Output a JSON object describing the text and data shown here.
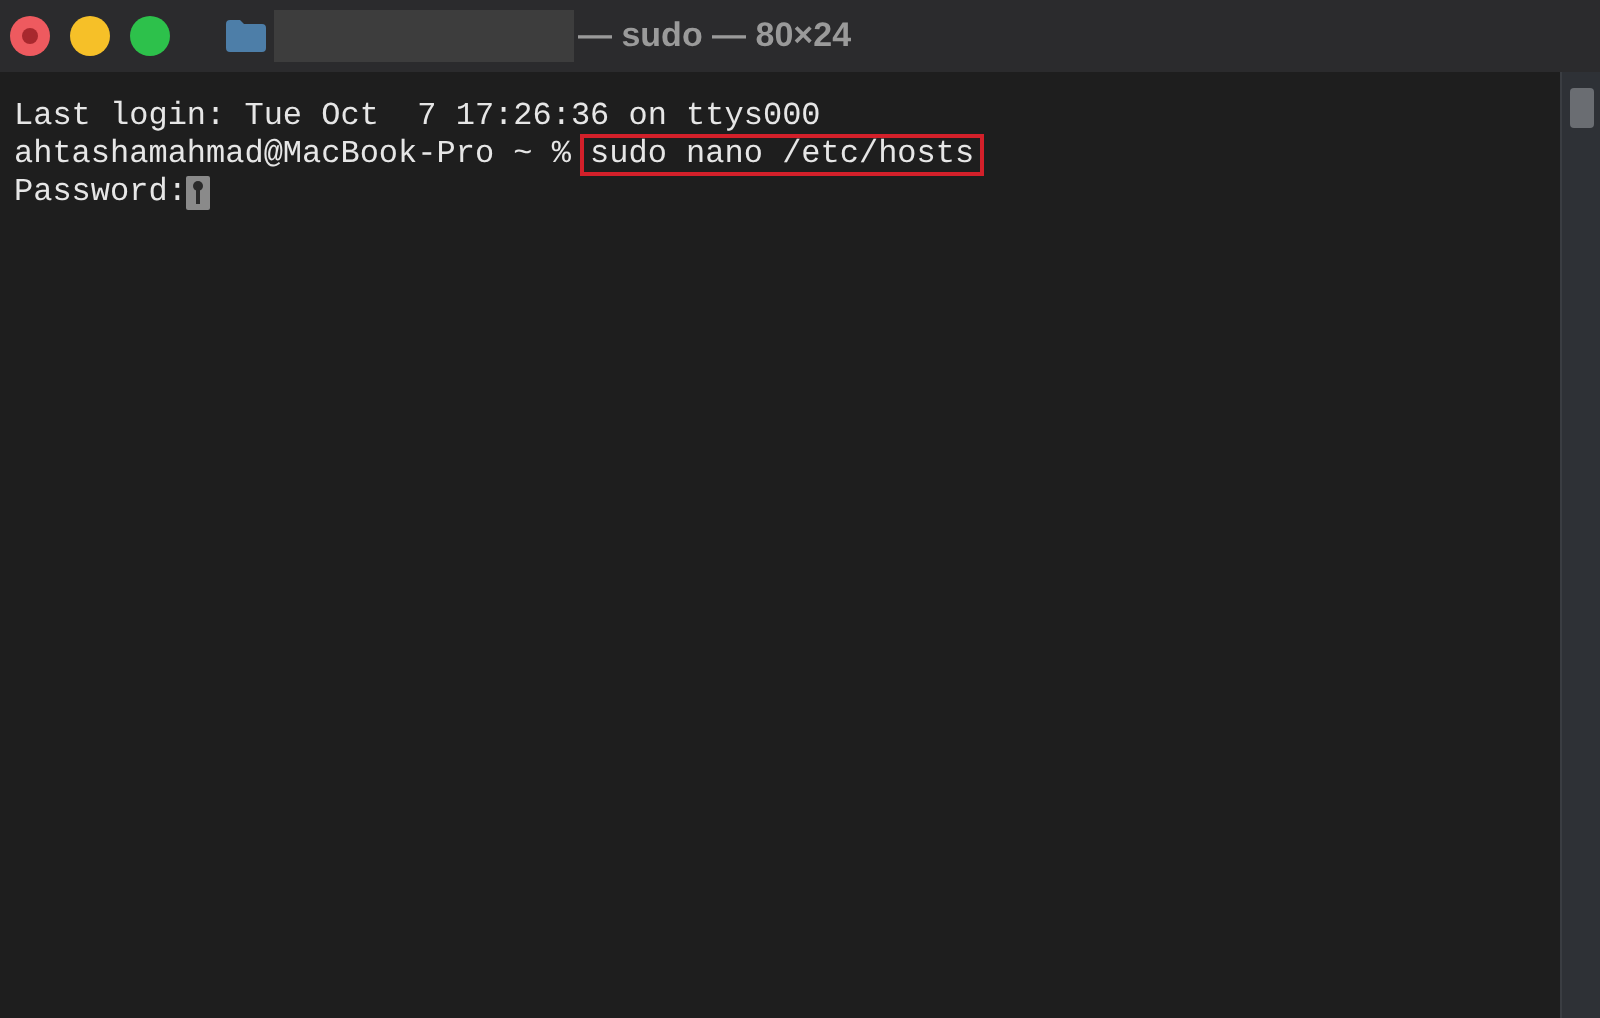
{
  "window": {
    "title": "— sudo — 80×24"
  },
  "terminal": {
    "lines": [
      {
        "kind": "output",
        "text": "Last login: Tue Oct  7 17:26:36 on ttys000"
      },
      {
        "kind": "command",
        "prompt": "ahtashamahmad@MacBook-Pro ~ %",
        "command": "sudo nano /etc/hosts",
        "highlighted": true
      },
      {
        "kind": "password",
        "text": "Password:"
      }
    ]
  }
}
